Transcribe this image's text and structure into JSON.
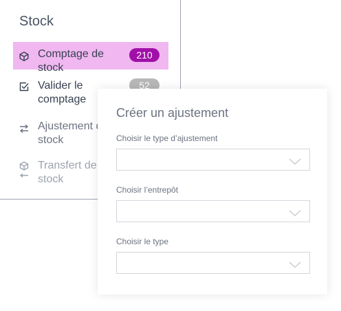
{
  "sidebar": {
    "title": "Stock",
    "items": [
      {
        "label": "Comptage de stock",
        "badge": "210",
        "icon": "cube-icon",
        "active": true
      },
      {
        "label": "Valider le comptage",
        "badge": "52",
        "icon": "checkbox-icon",
        "active": false
      },
      {
        "label": "Ajustement de stock",
        "icon": "swap-arrows-icon",
        "active": false
      },
      {
        "label": "Transfert de stock",
        "icon": "cube-arrow-icon",
        "active": false
      }
    ]
  },
  "panel": {
    "title": "Créer un ajustement",
    "fields": [
      {
        "label": "Choisir le type d’ajustement",
        "value": ""
      },
      {
        "label": "Choisir l’entrepôt",
        "value": ""
      },
      {
        "label": "Choisir le type",
        "value": ""
      }
    ]
  },
  "colors": {
    "active_bg": "#f0b7f0",
    "badge_purple": "#a010a8",
    "badge_gray": "#b8b8b8"
  }
}
